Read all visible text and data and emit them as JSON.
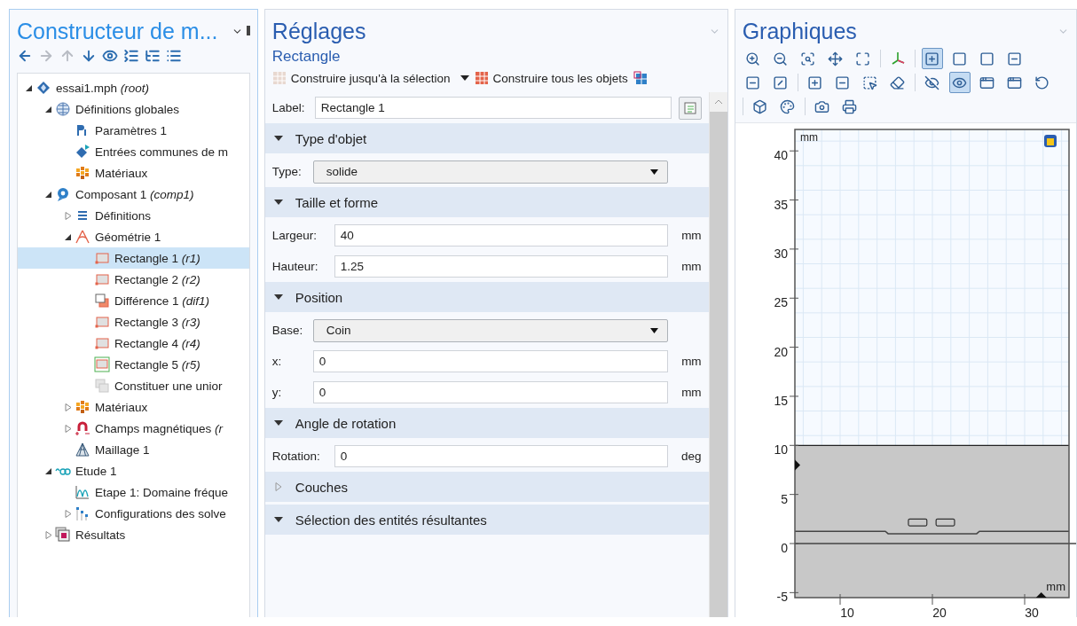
{
  "model_builder": {
    "title": "Constructeur de m...",
    "toolbar": [
      {
        "kind": "back",
        "disabled": false
      },
      {
        "kind": "forward",
        "disabled": true
      },
      {
        "kind": "up",
        "disabled": true
      },
      {
        "kind": "down",
        "disabled": false
      },
      {
        "kind": "show",
        "disabled": false
      },
      {
        "kind": "collapse",
        "disabled": false
      },
      {
        "kind": "expand",
        "disabled": false
      },
      {
        "kind": "list",
        "disabled": false
      }
    ],
    "tree": [
      {
        "kind": "file",
        "label": "essai1.mph *(root)*",
        "expanded": true,
        "selected": false,
        "children": [
          {
            "kind": "globe",
            "label": "Définitions globales",
            "expanded": true,
            "selected": false,
            "children": [
              {
                "kind": "param",
                "label": "Paramètres 1",
                "selected": false
              },
              {
                "kind": "inputs",
                "label": "Entrées communes de m",
                "selected": false
              },
              {
                "kind": "materials",
                "label": "Matériaux",
                "selected": false
              }
            ]
          },
          {
            "kind": "component",
            "label": "Composant 1 *(comp1)*",
            "expanded": true,
            "selected": false,
            "children": [
              {
                "kind": "list",
                "label": "Définitions",
                "expanded": false,
                "selected": false
              },
              {
                "kind": "geometry",
                "label": "Géométrie 1",
                "expanded": true,
                "selected": false,
                "children": [
                  {
                    "kind": "rectangle",
                    "label": "Rectangle 1 *(r1)*",
                    "selected": true
                  },
                  {
                    "kind": "rectangle",
                    "label": "Rectangle 2 *(r2)*",
                    "selected": false
                  },
                  {
                    "kind": "difference",
                    "label": "Différence 1 *(dif1)*",
                    "selected": false
                  },
                  {
                    "kind": "rectangle",
                    "label": "Rectangle 3 *(r3)*",
                    "selected": false
                  },
                  {
                    "kind": "rectangle",
                    "label": "Rectangle 4 *(r4)*",
                    "selected": false
                  },
                  {
                    "kind": "rectangle-framed",
                    "label": "Rectangle 5 *(r5)*",
                    "selected": false
                  },
                  {
                    "kind": "union",
                    "label": "Constituer une unior",
                    "selected": false
                  }
                ]
              },
              {
                "kind": "materials",
                "label": "Matériaux",
                "expanded": false,
                "selected": false
              },
              {
                "kind": "physics",
                "label": "Champs magnétiques *(r*",
                "expanded": false,
                "selected": false
              },
              {
                "kind": "mesh",
                "label": "Maillage 1",
                "selected": false
              }
            ]
          },
          {
            "kind": "study",
            "label": "Etude 1",
            "expanded": true,
            "selected": false,
            "children": [
              {
                "kind": "step",
                "label": "Etape 1: Domaine fréque",
                "selected": false
              },
              {
                "kind": "solver",
                "label": "Configurations des solve",
                "expanded": false,
                "selected": false
              }
            ]
          },
          {
            "kind": "results",
            "label": "Résultats",
            "expanded": false,
            "selected": false
          }
        ]
      }
    ]
  },
  "settings": {
    "title": "Réglages",
    "subtitle": "Rectangle",
    "actions": [
      {
        "label": "Construire jusqu'à la sélection",
        "menu": true
      },
      {
        "label": "Construire tous les objets",
        "menu": false
      }
    ],
    "label_field": {
      "label": "Label:",
      "value": "Rectangle 1"
    },
    "sections": [
      {
        "title": "Type d'objet",
        "expanded": true,
        "fields": [
          {
            "kind": "select",
            "label": "Type:",
            "value": "solide"
          }
        ]
      },
      {
        "title": "Taille et forme",
        "expanded": true,
        "fields": [
          {
            "kind": "text",
            "label": "Largeur:",
            "value": "40",
            "unit": "mm"
          },
          {
            "kind": "text",
            "label": "Hauteur:",
            "value": "1.25",
            "unit": "mm"
          }
        ]
      },
      {
        "title": "Position",
        "expanded": true,
        "fields": [
          {
            "kind": "select",
            "label": "Base:",
            "value": "Coin"
          },
          {
            "kind": "text",
            "label": "x:",
            "value": "0",
            "unit": "mm"
          },
          {
            "kind": "text",
            "label": "y:",
            "value": "0",
            "unit": "mm"
          }
        ]
      },
      {
        "title": "Angle de rotation",
        "expanded": true,
        "fields": [
          {
            "kind": "text",
            "label": "Rotation:",
            "value": "0",
            "unit": "deg"
          }
        ]
      },
      {
        "title": "Couches",
        "expanded": false
      },
      {
        "title": "Sélection des entités résultantes",
        "expanded": true
      }
    ]
  },
  "graphics": {
    "title": "Graphiques",
    "toolbar": [
      [
        {
          "kind": "zoom-in",
          "selected": false
        },
        {
          "kind": "zoom-out",
          "selected": false
        },
        {
          "kind": "zoom-box",
          "selected": false
        },
        {
          "kind": "center",
          "selected": false
        },
        {
          "kind": "extents",
          "selected": false
        },
        {
          "kind": "sep"
        },
        {
          "kind": "axes",
          "selected": false
        },
        {
          "kind": "sep"
        },
        {
          "kind": "select-mode",
          "selected": true
        },
        {
          "kind": "domains",
          "selected": false
        },
        {
          "kind": "solid",
          "selected": false
        },
        {
          "kind": "boundary",
          "selected": false
        }
      ],
      [
        {
          "kind": "edges",
          "selected": false
        },
        {
          "kind": "no-select",
          "selected": false
        },
        {
          "kind": "sep"
        },
        {
          "kind": "add",
          "selected": false
        },
        {
          "kind": "remove",
          "selected": false
        },
        {
          "kind": "box-select",
          "selected": false
        },
        {
          "kind": "clear",
          "selected": false
        },
        {
          "kind": "sep"
        },
        {
          "kind": "hide",
          "selected": false
        },
        {
          "kind": "view",
          "selected": true
        },
        {
          "kind": "hidden",
          "selected": false
        },
        {
          "kind": "show-hidden",
          "selected": false
        },
        {
          "kind": "reset",
          "selected": false
        }
      ],
      [
        {
          "kind": "sep"
        },
        {
          "kind": "transparency",
          "selected": false
        },
        {
          "kind": "palette",
          "selected": false
        },
        {
          "kind": "sep"
        },
        {
          "kind": "camera",
          "selected": false
        },
        {
          "kind": "print",
          "selected": false
        }
      ]
    ],
    "unit_top": "mm",
    "unit_bottom": "mm",
    "y_ticks": [
      "40",
      "35",
      "30",
      "25",
      "20",
      "15",
      "10",
      "5",
      "0",
      "-5"
    ],
    "x_ticks": [
      "10",
      "20",
      "30"
    ]
  }
}
